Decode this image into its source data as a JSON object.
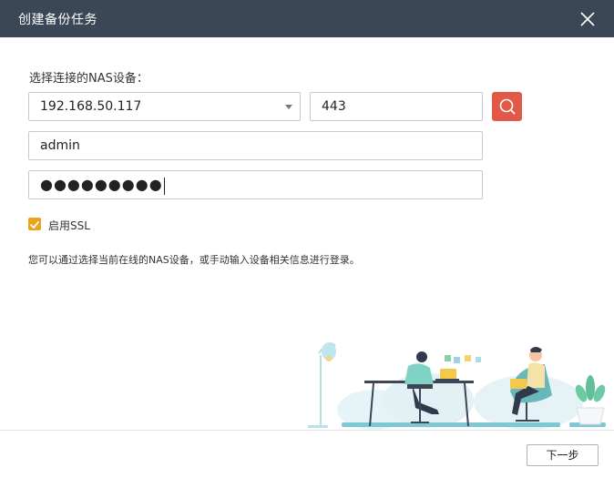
{
  "dialog": {
    "title": "创建备份任务"
  },
  "form": {
    "prompt": "选择连接的NAS设备：",
    "host": "192.168.50.117",
    "port": "443",
    "username": "admin",
    "password_masked": "●●●●●●●●●",
    "ssl": {
      "label": "启用SSL",
      "checked": true
    }
  },
  "hint": "您可以通过选择当前在线的NAS设备，或手动输入设备相关信息进行登录。",
  "footer": {
    "next_label": "下一步"
  },
  "colors": {
    "titlebar": "#3b4656",
    "search_button": "#e05a47",
    "checkbox": "#e9a41a"
  }
}
